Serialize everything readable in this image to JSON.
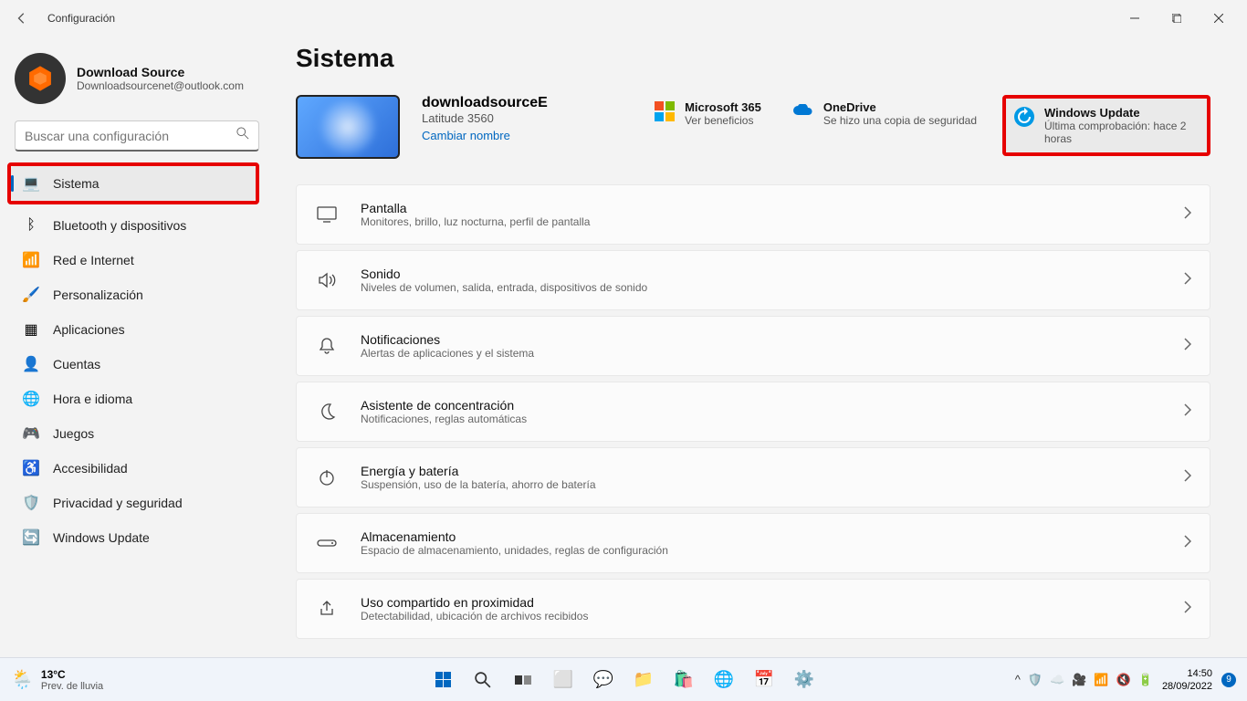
{
  "window": {
    "title": "Configuración"
  },
  "user": {
    "name": "Download Source",
    "email": "Downloadsourcenet@outlook.com"
  },
  "search": {
    "placeholder": "Buscar una configuración"
  },
  "nav": [
    {
      "label": "Sistema",
      "icon": "💻",
      "active": true
    },
    {
      "label": "Bluetooth y dispositivos",
      "icon": "ᛒ"
    },
    {
      "label": "Red e Internet",
      "icon": "📶"
    },
    {
      "label": "Personalización",
      "icon": "🖌️"
    },
    {
      "label": "Aplicaciones",
      "icon": "▦"
    },
    {
      "label": "Cuentas",
      "icon": "👤"
    },
    {
      "label": "Hora e idioma",
      "icon": "🌐"
    },
    {
      "label": "Juegos",
      "icon": "🎮"
    },
    {
      "label": "Accesibilidad",
      "icon": "♿"
    },
    {
      "label": "Privacidad y seguridad",
      "icon": "🛡️"
    },
    {
      "label": "Windows Update",
      "icon": "🔄"
    }
  ],
  "page": {
    "title": "Sistema",
    "device": {
      "name": "downloadsourceE",
      "model": "Latitude 3560",
      "rename": "Cambiar nombre"
    },
    "cards": {
      "ms365": {
        "title": "Microsoft 365",
        "desc": "Ver beneficios"
      },
      "onedrive": {
        "title": "OneDrive",
        "desc": "Se hizo una copia de seguridad"
      },
      "wu": {
        "title": "Windows Update",
        "desc": "Última comprobación: hace 2 horas"
      }
    },
    "settings": [
      {
        "title": "Pantalla",
        "desc": "Monitores, brillo, luz nocturna, perfil de pantalla",
        "icon": "monitor"
      },
      {
        "title": "Sonido",
        "desc": "Niveles de volumen, salida, entrada, dispositivos de sonido",
        "icon": "sound"
      },
      {
        "title": "Notificaciones",
        "desc": "Alertas de aplicaciones y el sistema",
        "icon": "bell"
      },
      {
        "title": "Asistente de concentración",
        "desc": "Notificaciones, reglas automáticas",
        "icon": "moon"
      },
      {
        "title": "Energía y batería",
        "desc": "Suspensión, uso de la batería, ahorro de batería",
        "icon": "power"
      },
      {
        "title": "Almacenamiento",
        "desc": "Espacio de almacenamiento, unidades, reglas de configuración",
        "icon": "storage"
      },
      {
        "title": "Uso compartido en proximidad",
        "desc": "Detectabilidad, ubicación de archivos recibidos",
        "icon": "share"
      }
    ]
  },
  "taskbar": {
    "weather": {
      "temp": "13°C",
      "cond": "Prev. de lluvia"
    },
    "time": "14:50",
    "date": "28/09/2022",
    "notif_count": "9"
  }
}
